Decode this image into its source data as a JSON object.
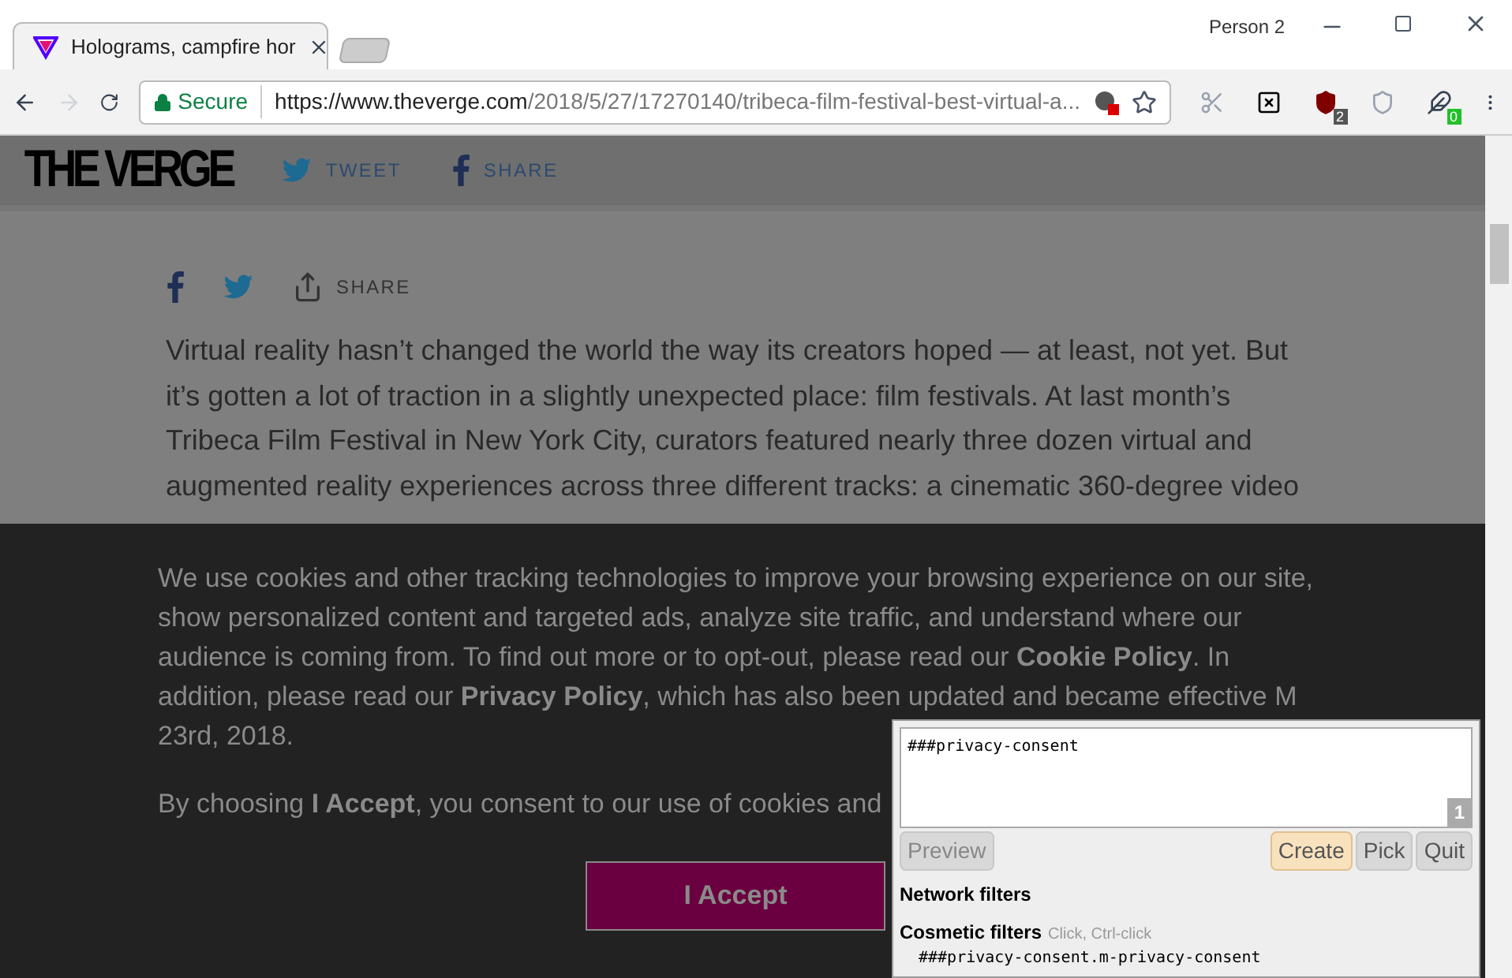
{
  "browser": {
    "profile": "Person 2",
    "tabs": [
      {
        "title": "Holograms, campfire hor",
        "selected": true
      }
    ],
    "security_label": "Secure",
    "url": {
      "host": "https://www.theverge.com",
      "path": "/2018/5/27/17270140/tribeca-film-festival-best-virtual-a..."
    },
    "extensions": [
      {
        "kind": "scissors"
      },
      {
        "kind": "boxed-x"
      },
      {
        "kind": "shield",
        "badge": "2"
      },
      {
        "kind": "outline-shield"
      },
      {
        "kind": "bird",
        "badge": "0"
      }
    ]
  },
  "site_header": {
    "logo": "THE VERGE",
    "share_links": [
      {
        "kind": "twitter",
        "label": "TWEET"
      },
      {
        "kind": "facebook",
        "label": "SHARE"
      }
    ]
  },
  "article": {
    "share_label": "SHARE",
    "lines": [
      "Virtual reality hasn’t changed the world the way its creators hoped — at least, not yet. But",
      "it’s gotten a lot of traction in a slightly unexpected place: film festivals. At last month’s",
      "Tribeca Film Festival in New York City, curators featured nearly three dozen virtual and",
      "augmented reality experiences across three different tracks: a cinematic 360-degree video"
    ]
  },
  "cookie_banner": {
    "paragraphs": [
      "We use cookies and other tracking technologies to improve your browsing experience on our site, show personalized content and targeted ads, analyze site traffic, and understand where our audience is coming from. To find out more or to opt-out, please read our **Cookie Policy**. In addition, please read our **Privacy Policy**, which has also been updated and became effective M",
      "23rd, 2018.",
      "By choosing **I Accept**, you consent to our use of cookies and"
    ],
    "accept_button": "I Accept"
  },
  "picker": {
    "filter_text": "###privacy-consent",
    "count": "1",
    "buttons": [
      {
        "label": "Preview",
        "highlighted": false,
        "disabled": true
      },
      {
        "label": "Create",
        "highlighted": true,
        "disabled": false
      },
      {
        "label": "Pick",
        "highlighted": false,
        "disabled": false
      },
      {
        "label": "Quit",
        "highlighted": false,
        "disabled": false
      }
    ],
    "network_heading": "Network filters",
    "cosmetic_heading": "Cosmetic filters",
    "cosmetic_hint": "Click, Ctrl-click",
    "cosmetic_filters": [
      "###privacy-consent.m-privacy-consent"
    ]
  }
}
